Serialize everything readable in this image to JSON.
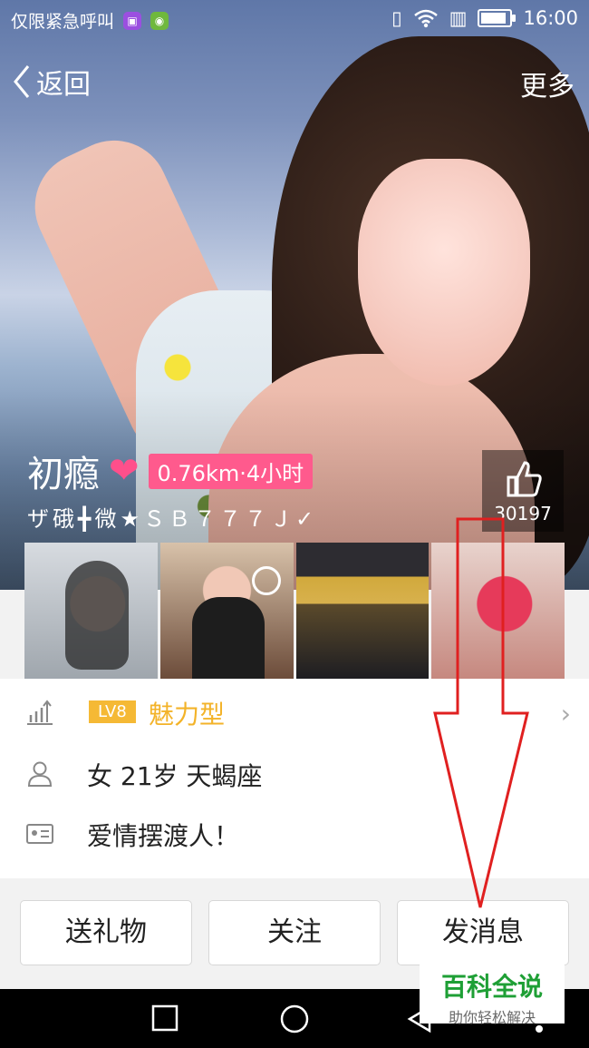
{
  "status_bar": {
    "carrier_text": "仅限紧急呼叫",
    "time": "16:00",
    "icons": [
      "gallery-icon",
      "app-icon",
      "vibrate-icon",
      "wifi-icon",
      "data-icon",
      "battery-icon"
    ]
  },
  "header": {
    "back_label": "返回",
    "more_label": "更多"
  },
  "profile": {
    "name": "初瘾",
    "distance_time": "0.76km·4小时",
    "signature": "ザ硪╋微★ＳＢ７７７Ｊ✓",
    "like_count": "30197"
  },
  "photos": [
    {
      "name": "photo-1"
    },
    {
      "name": "photo-2"
    },
    {
      "name": "photo-3"
    },
    {
      "name": "photo-4"
    }
  ],
  "details": {
    "level": "LV8",
    "type_label": "魅力型",
    "basic_info": "女 21岁 天蝎座",
    "bio": "爱情摆渡人！"
  },
  "actions": {
    "gift_label": "送礼物",
    "follow_label": "关注",
    "message_label": "发消息"
  },
  "watermark": {
    "title": "百科全说",
    "subtitle": "助你轻松解决"
  },
  "colors": {
    "pink_badge": "#ff5a8d",
    "level_orange": "#f5b935",
    "annotation_red": "#e02020",
    "watermark_green": "#1e9f35"
  }
}
